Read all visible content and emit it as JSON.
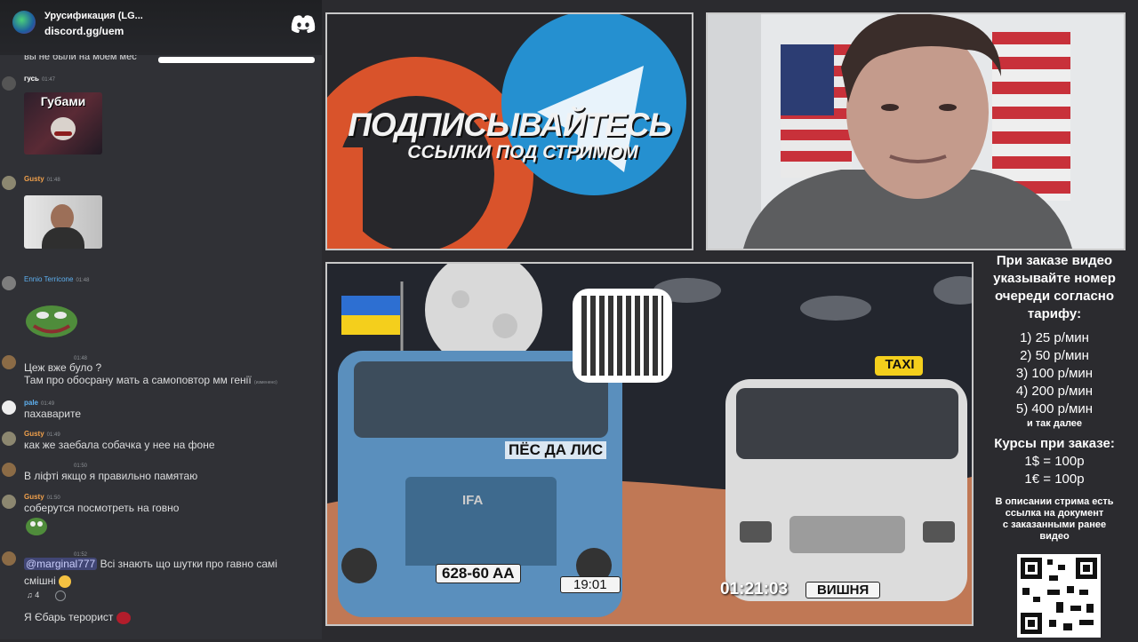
{
  "discord": {
    "server_name": "Урусификация (LG...",
    "invite": "discord.gg/uem"
  },
  "chat": {
    "partial_top": "вы не были на моем мес",
    "messages": [
      {
        "user": "гусь",
        "time": "01:47",
        "image_caption": "Губами",
        "user_color": "#ffffff"
      },
      {
        "user": "Gusty",
        "time": "01:48",
        "user_color": "#f0a04b"
      },
      {
        "user": "Ennio Terricone",
        "time": "01:48",
        "user_color": "#5eb0f0"
      },
      {
        "user": "",
        "time": "01:48",
        "text1": "Цеж вже було ?",
        "text2": "Там про обосрану мать а самоповтор мм генії",
        "edited": "(изменено)",
        "user_color": "#8b6b46"
      },
      {
        "user": "pale",
        "time": "01:49",
        "text1": "пахаварите",
        "user_color": "#ffffff"
      },
      {
        "user": "Gusty",
        "time": "01:49",
        "text1": "как же заебала собачка у нее на фоне",
        "user_color": "#f0a04b"
      },
      {
        "user": "",
        "time": "01:50",
        "text1": "В ліфті якщо я правильно памятаю",
        "user_color": "#8b6b46"
      },
      {
        "user": "Gusty",
        "time": "01:50",
        "text1": "соберутся посмотреть на говно",
        "user_color": "#f0a04b"
      },
      {
        "user": "",
        "time": "01:52",
        "mention": "@marginal777",
        "text1": "Всі знають що шутки про гавно самі",
        "text2": "смішні",
        "reaction_count": "4",
        "user_color": "#8b6b46"
      },
      {
        "user": "",
        "time": "",
        "text1": "Я Єбарь терорист",
        "user_color": "#ffffff"
      }
    ]
  },
  "promo": {
    "title": "ПОДПИСЫВАЙТЕСЬ",
    "subtitle": "ССЫЛКИ ПОД СТРИМОМ"
  },
  "scene": {
    "bus_name": "ПЁС ДА ЛИС",
    "bus_brand": "IFA",
    "bus_plate": "628-60 AA",
    "bus_timer": "19:01",
    "taxi_sign": "TAXI",
    "taxi_timer": "01:21:03",
    "taxi_plate": "ВИШНЯ"
  },
  "order_info": {
    "heading_lines": [
      "При заказе видео",
      "указывайте номер",
      "очереди согласно",
      "тарифу:"
    ],
    "tariffs": [
      "1) 25 р/мин",
      "2) 50 р/мин",
      "3) 100 р/мин",
      "4) 200 р/мин",
      "5) 400 р/мин"
    ],
    "etc": "и так далее",
    "rates_heading": "Курсы при заказе:",
    "rates": [
      "1$ = 100р",
      "1€ = 100р"
    ],
    "desc_lines": [
      "В описании стрима есть",
      "ссылка на документ",
      "с заказанными ранее",
      "видео"
    ]
  },
  "colors": {
    "chat_bg": "#303136",
    "accent_blue": "#2590d0",
    "accent_orange": "#e05a2b"
  }
}
